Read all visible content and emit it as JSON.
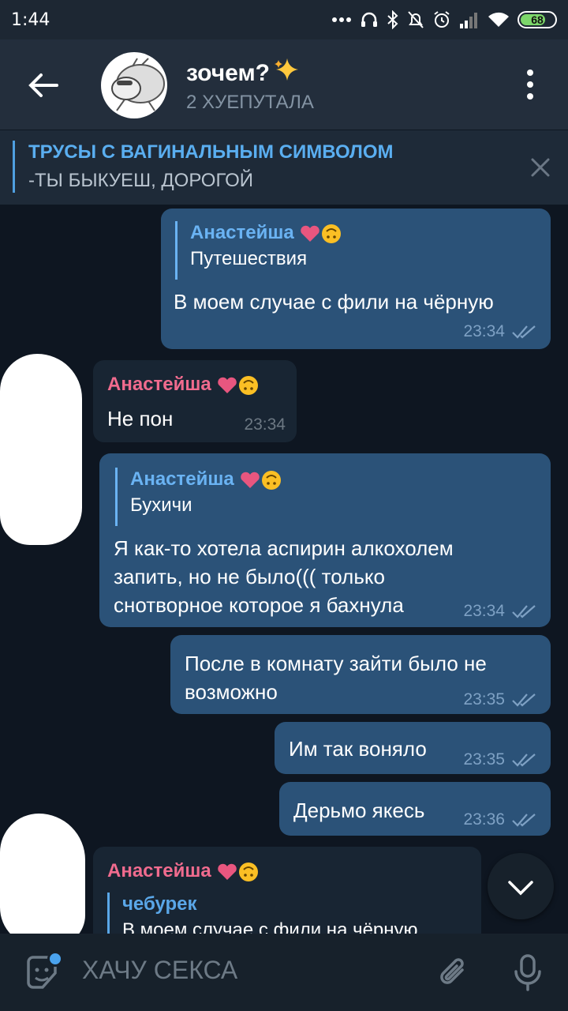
{
  "status_bar": {
    "time": "1:44",
    "battery": "68"
  },
  "header": {
    "title": "зочем?",
    "subtitle": "2 ХУЕПУТАЛА"
  },
  "pinned": {
    "title": "ТРУСЫ С ВАГИНАЛЬНЫМ СИМВОЛОМ",
    "text": "-ТЫ БЫКУЕШ, ДОРОГОЙ"
  },
  "messages": [
    {
      "dir": "out",
      "reply_name": "Анастейша",
      "reply_text": "Путешествия",
      "text": "В моем случае с фили на чёрную",
      "time": "23:34"
    },
    {
      "dir": "in",
      "sender": "Анастейша",
      "text": "Не пон",
      "time": "23:34"
    },
    {
      "dir": "out",
      "reply_name": "Анастейша",
      "reply_text": "Бухичи",
      "text": "Я как-то хотела аспирин алкохолем\nзапить, но не было((( только\nснотворное которое я бахнула",
      "time": "23:34"
    },
    {
      "dir": "out",
      "text": "После в комнату зайти было не\nвозможно",
      "time": "23:35"
    },
    {
      "dir": "out",
      "text": "Им так воняло",
      "time": "23:35"
    },
    {
      "dir": "out",
      "text": "Дерьмо якесь",
      "time": "23:36"
    },
    {
      "dir": "in",
      "sender": "Анастейша",
      "reply_name": "чебурек",
      "reply_text": "В моем случае с фили на чёрную"
    }
  ],
  "input": {
    "placeholder": "ХАЧУ СЕКСА"
  },
  "colors": {
    "accent": "#6ab3f3",
    "out_bubble": "#2b5278",
    "in_bubble": "#182533",
    "sender_name": "#f06b8e"
  }
}
